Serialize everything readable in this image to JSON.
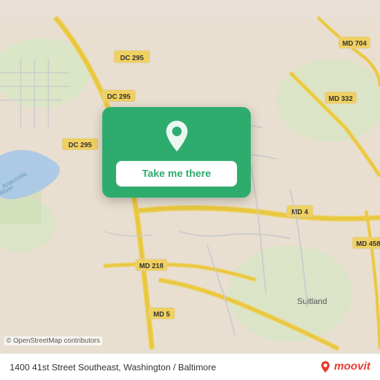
{
  "map": {
    "background_color": "#e8dfd0",
    "osm_credit": "© OpenStreetMap contributors"
  },
  "card": {
    "button_label": "Take me there",
    "pin_color": "#ffffff",
    "background_color": "#2eac6d"
  },
  "bottom_bar": {
    "address": "1400 41st Street Southeast, Washington / Baltimore",
    "moovit_label": "moovit"
  }
}
